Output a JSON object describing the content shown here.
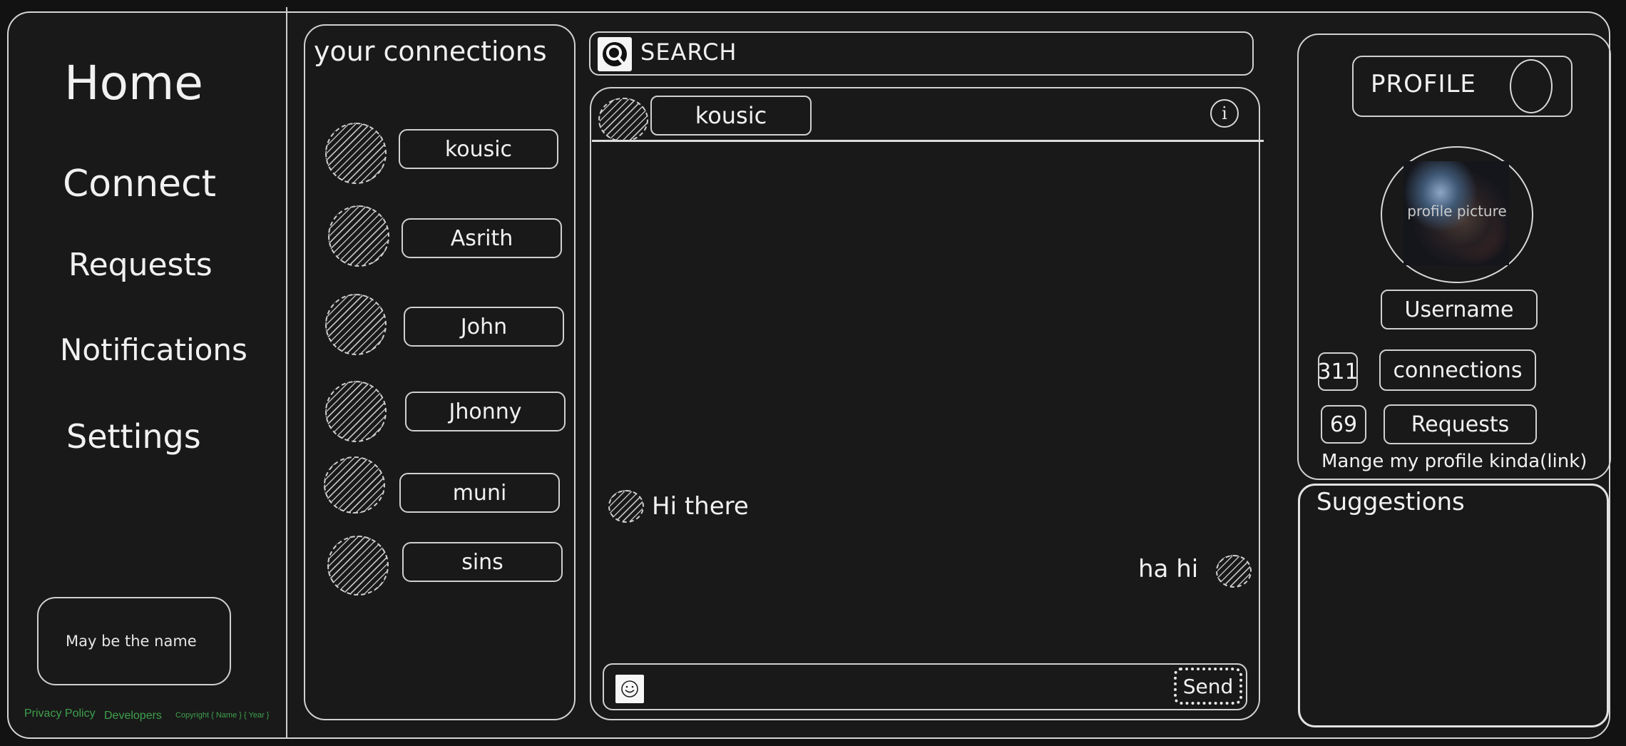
{
  "nav": {
    "home": "Home",
    "connect": "Connect",
    "requests": "Requests",
    "notifications": "Notifications",
    "settings": "Settings"
  },
  "sidebar": {
    "name_box": "May be the name"
  },
  "footer": {
    "privacy": "Privacy Policy",
    "developers": "Developers",
    "copyright": "Copyright { Name } { Year }"
  },
  "connections": {
    "title": "your connections",
    "items": [
      {
        "name": "kousic"
      },
      {
        "name": "Asrith"
      },
      {
        "name": "John"
      },
      {
        "name": "Jhonny"
      },
      {
        "name": "muni"
      },
      {
        "name": "sins"
      }
    ]
  },
  "search": {
    "label": "SEARCH",
    "icon": "search-icon"
  },
  "chat": {
    "contact_name": "kousic",
    "info_icon": "info-icon",
    "messages": [
      {
        "text": "Hi there",
        "side": "incoming"
      },
      {
        "text": "ha hi",
        "side": "outgoing"
      }
    ],
    "compose_placeholder": "",
    "emoji_icon": "smiley-icon",
    "send_label": "Send"
  },
  "profile": {
    "title": "PROFILE",
    "avatar_caption": "profile picture",
    "username": "Username",
    "connections_count": "311",
    "connections_label": "connections",
    "requests_count": "69",
    "requests_label": "Requests",
    "manage_link": "Mange my profile kinda(link)"
  },
  "suggestions": {
    "title": "Suggestions"
  },
  "colors": {
    "background": "#191919",
    "outline": "#d0d0d0",
    "footer_link": "#3fa04d"
  }
}
